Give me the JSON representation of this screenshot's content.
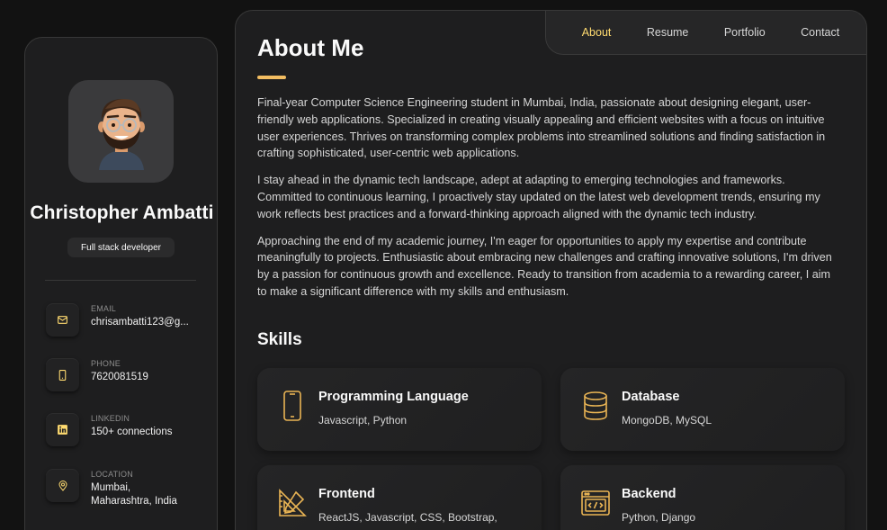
{
  "profile": {
    "name": "Christopher Ambatti",
    "title": "Full stack developer",
    "avatar_icon": "memoji-avatar"
  },
  "contacts": [
    {
      "label": "EMAIL",
      "value": "chrisambatti123@g...",
      "icon": "mail-icon"
    },
    {
      "label": "PHONE",
      "value": "7620081519",
      "icon": "phone-icon"
    },
    {
      "label": "LINKEDIN",
      "value": "150+ connections",
      "icon": "linkedin-icon"
    },
    {
      "label": "LOCATION",
      "value": "Mumbai, Maharashtra, India",
      "icon": "location-pin-icon"
    }
  ],
  "nav": {
    "items": [
      "About",
      "Resume",
      "Portfolio",
      "Contact"
    ],
    "active": "About"
  },
  "about": {
    "heading": "About Me",
    "paragraphs": [
      "Final-year Computer Science Engineering student in Mumbai, India, passionate about designing elegant, user-friendly web applications. Specialized in creating visually appealing and efficient websites with a focus on intuitive user experiences. Thrives on transforming complex problems into streamlined solutions and finding satisfaction in crafting sophisticated, user-centric web applications.",
      "I stay ahead in the dynamic tech landscape, adept at adapting to emerging technologies and frameworks. Committed to continuous learning, I proactively stay updated on the latest web development trends, ensuring my work reflects best practices and a forward-thinking approach aligned with the dynamic tech industry.",
      "Approaching the end of my academic journey, I'm eager for opportunities to apply my expertise and contribute meaningfully to projects. Enthusiastic about embracing new challenges and crafting innovative solutions, I'm driven by a passion for continuous growth and excellence. Ready to transition from academia to a rewarding career, I aim to make a significant difference with my skills and enthusiasm."
    ]
  },
  "skills": {
    "heading": "Skills",
    "items": [
      {
        "title": "Programming Language",
        "desc": "Javascript, Python",
        "icon": "mobile-device-icon"
      },
      {
        "title": "Database",
        "desc": "MongoDB, MySQL",
        "icon": "database-icon"
      },
      {
        "title": "Frontend",
        "desc": "ReactJS, Javascript, CSS, Bootstrap,",
        "icon": "design-tools-icon"
      },
      {
        "title": "Backend",
        "desc": "Python, Django",
        "icon": "code-window-icon"
      }
    ]
  },
  "colors": {
    "accent": "#ffdb70",
    "accent_bar": "#f2bd61",
    "page_bg": "#121212",
    "card_bg": "#1e1e1f"
  }
}
